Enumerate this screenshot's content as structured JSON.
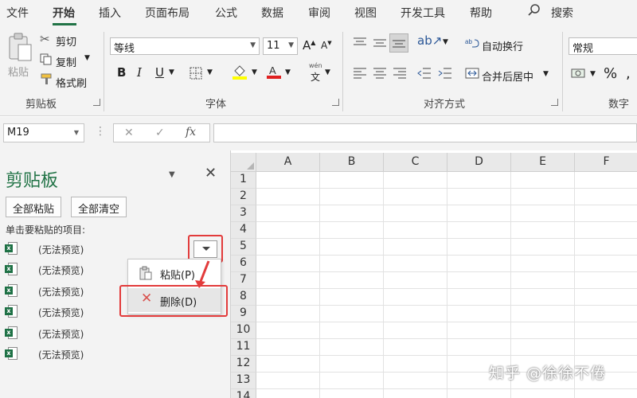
{
  "menu": {
    "tabs": [
      "文件",
      "开始",
      "插入",
      "页面布局",
      "公式",
      "数据",
      "审阅",
      "视图",
      "开发工具",
      "帮助"
    ],
    "active_tab": "开始",
    "search_label": "搜索"
  },
  "ribbon": {
    "clipboard": {
      "paste_label": "粘贴",
      "cut_label": "剪切",
      "copy_label": "复制",
      "format_painter_label": "格式刷",
      "group_label": "剪贴板"
    },
    "font": {
      "font_name": "等线",
      "font_size": "11",
      "phonetic_top": "wén",
      "phonetic_bottom": "文",
      "group_label": "字体"
    },
    "alignment": {
      "wrap_text_label": "自动换行",
      "merge_center_label": "合并后居中",
      "group_label": "对齐方式"
    },
    "number": {
      "format_value": "常规",
      "group_label": "数字",
      "percent": "%"
    }
  },
  "formula_bar": {
    "name_box": "M19",
    "fx_label": "fx",
    "cancel": "✕",
    "enter": "✓",
    "formula": ""
  },
  "clipboard_pane": {
    "title": "剪贴板",
    "paste_all_label": "全部粘贴",
    "clear_all_label": "全部清空",
    "hint": "单击要粘贴的项目:",
    "items": [
      "(无法预览)",
      "(无法预览)",
      "(无法预览)",
      "(无法预览)",
      "(无法预览)",
      "(无法预览)"
    ],
    "context_menu": {
      "paste_label": "粘贴(P)",
      "delete_label": "删除(D)"
    }
  },
  "sheet": {
    "columns": [
      "A",
      "B",
      "C",
      "D",
      "E",
      "F"
    ],
    "rows": [
      "1",
      "2",
      "3",
      "4",
      "5",
      "6",
      "7",
      "8",
      "9",
      "10",
      "11",
      "12",
      "13",
      "14"
    ]
  },
  "watermark": "知乎 @徐徐不倦",
  "colors": {
    "excel_green": "#217346",
    "highlight_red": "#e23b3b"
  }
}
